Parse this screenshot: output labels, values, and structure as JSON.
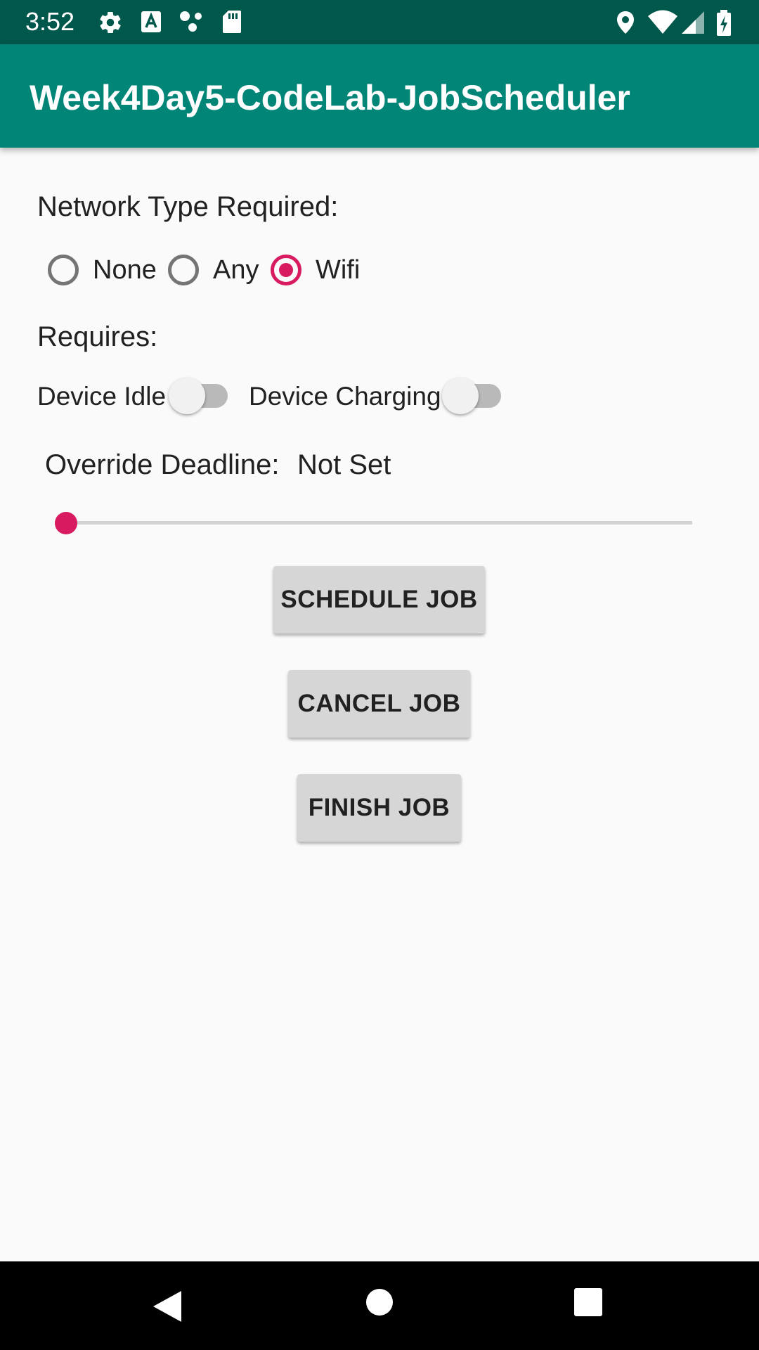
{
  "status_bar": {
    "time": "3:52",
    "left_icons": [
      "settings-icon",
      "text-a-icon",
      "dots-icon",
      "sd-card-icon"
    ],
    "right_icons": [
      "location-icon",
      "wifi-icon",
      "signal-icon",
      "battery-icon"
    ]
  },
  "app_bar": {
    "title": "Week4Day5-CodeLab-JobScheduler",
    "color": "#008577",
    "status_color": "#00574b"
  },
  "network": {
    "heading": "Network Type Required:",
    "options": [
      {
        "label": "None",
        "checked": false
      },
      {
        "label": "Any",
        "checked": false
      },
      {
        "label": "Wifi",
        "checked": true
      }
    ]
  },
  "requires": {
    "heading": "Requires:",
    "device_idle": {
      "label": "Device Idle",
      "on": false
    },
    "device_charging": {
      "label": "Device Charging",
      "on": false
    }
  },
  "deadline": {
    "label": "Override Deadline:",
    "value": "Not Set",
    "slider_fraction": 0
  },
  "buttons": {
    "schedule": "SCHEDULE JOB",
    "cancel": "CANCEL JOB",
    "finish": "FINISH JOB"
  },
  "nav_bar": {
    "icons": [
      "back-icon",
      "home-icon",
      "recents-icon"
    ]
  },
  "colors": {
    "accent": "#d81b60",
    "background": "#fafafa"
  }
}
